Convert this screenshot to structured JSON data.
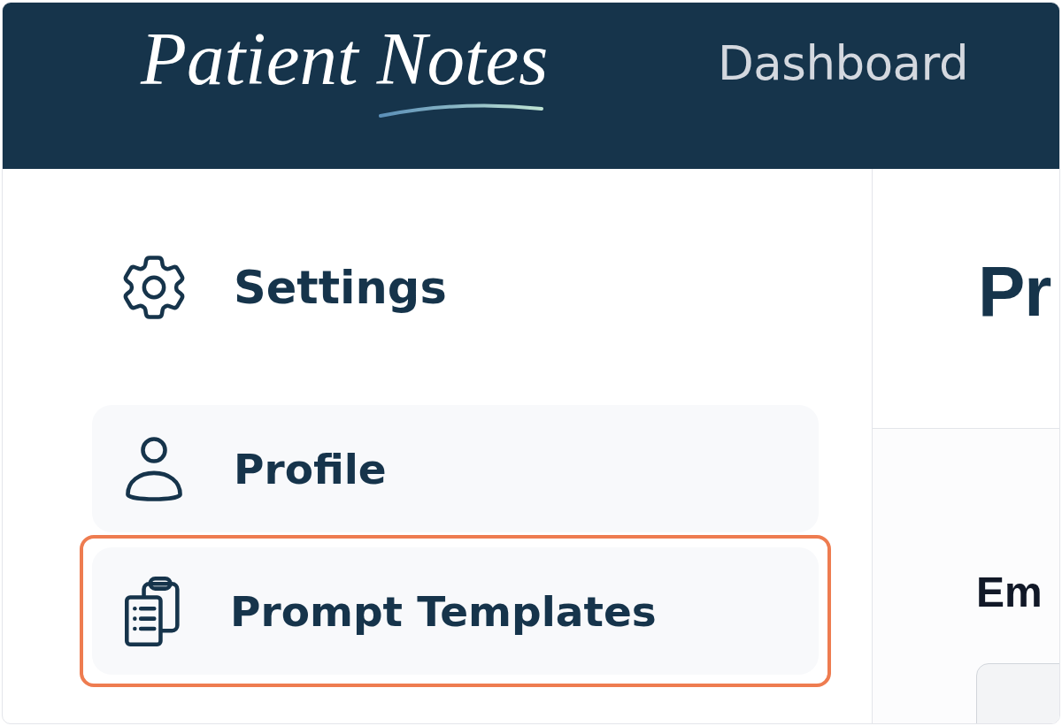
{
  "header": {
    "logo": "Patient Notes",
    "nav": [
      {
        "label": "Dashboard"
      }
    ]
  },
  "sidebar": {
    "title": "Settings",
    "items": [
      {
        "label": "Profile",
        "highlighted": false
      },
      {
        "label": "Prompt Templates",
        "highlighted": true
      }
    ]
  },
  "content": {
    "heading": "Pr",
    "field_label": "Em"
  }
}
